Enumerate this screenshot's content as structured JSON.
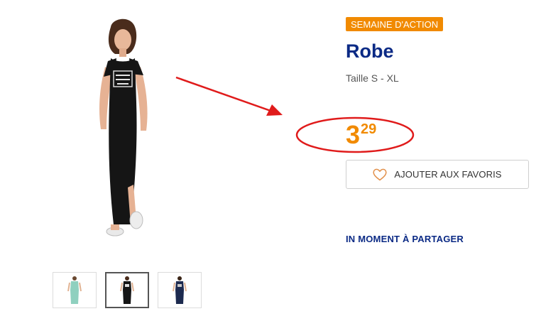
{
  "product": {
    "badge": "SEMAINE D'ACTION",
    "title": "Robe",
    "size": "Taille S - XL",
    "price_integer": "3",
    "price_decimal": "29"
  },
  "actions": {
    "favorites_label": "AJOUTER AUX FAVORIS",
    "share_label": "IN MOMENT À PARTAGER"
  },
  "gallery": {
    "selected_index": 1,
    "thumbnails": [
      {
        "icon": "dress-mint-thumbnail"
      },
      {
        "icon": "dress-black-thumbnail"
      },
      {
        "icon": "dress-navy-thumbnail"
      }
    ]
  },
  "colors": {
    "accent_orange": "#f18a00",
    "brand_blue": "#0b2a85",
    "annotation_red": "#e01b1b"
  }
}
